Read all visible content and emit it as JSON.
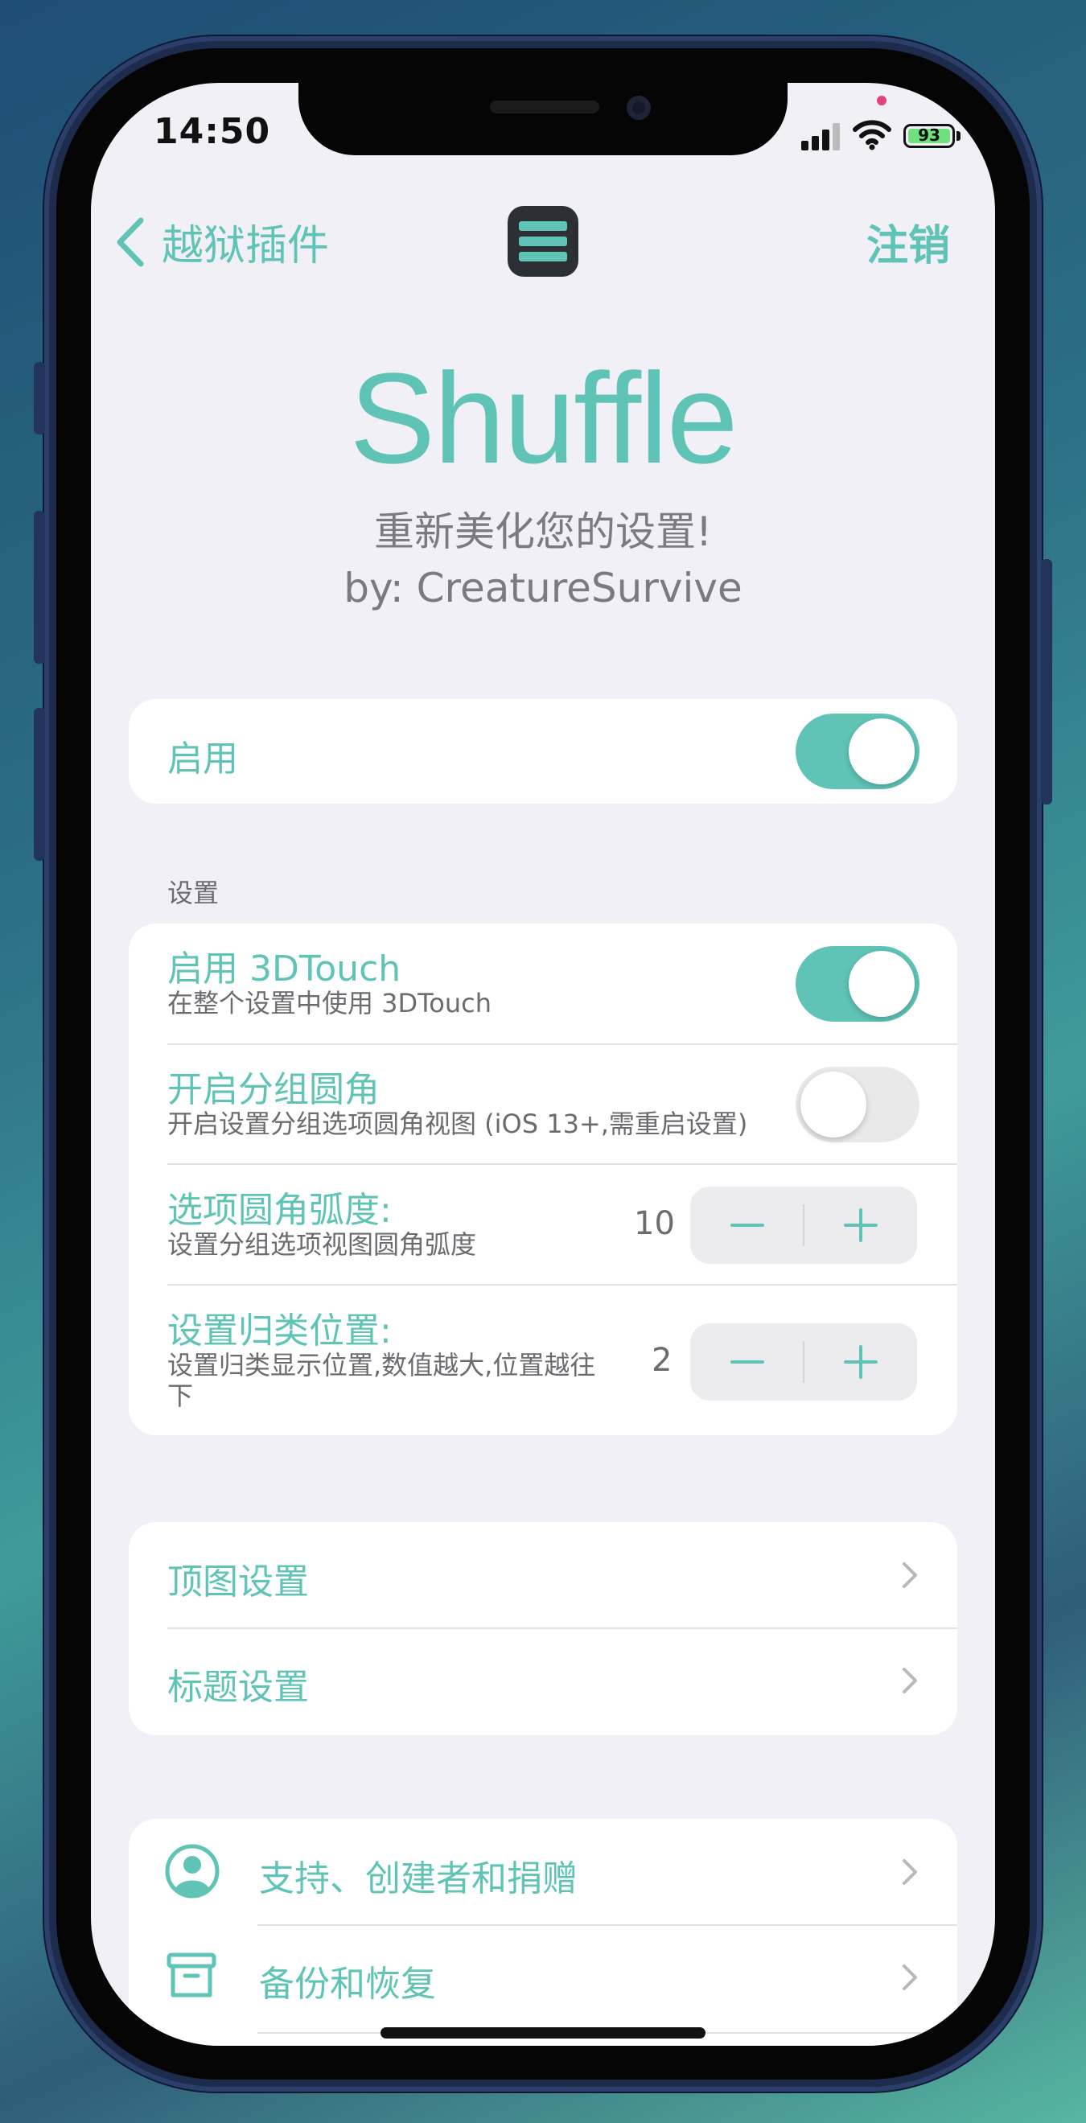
{
  "status_bar": {
    "time": "14:50",
    "battery": "93"
  },
  "nav": {
    "back_label": "越狱插件",
    "right_label": "注销"
  },
  "header": {
    "title": "Shuffle",
    "subtitle": "重新美化您的设置!",
    "author": "by: CreatureSurvive"
  },
  "enable_card": {
    "label": "启用",
    "toggle_on": true
  },
  "settings_section": {
    "header": "设置",
    "rows": [
      {
        "label": "启用 3DTouch",
        "sub": "在整个设置中使用 3DTouch",
        "toggle_on": true
      },
      {
        "label": "开启分组圆角",
        "sub": "开启设置分组选项圆角视图 (iOS 13+,需重启设置)",
        "toggle_on": false
      },
      {
        "label": "选项圆角弧度:",
        "sub": "设置分组选项视图圆角弧度",
        "value": "10"
      },
      {
        "label": "设置归类位置:",
        "sub": "设置归类显示位置,数值越大,位置越往下",
        "value": "2"
      }
    ]
  },
  "nav_card": {
    "items": [
      {
        "label": "顶图设置"
      },
      {
        "label": "标题设置"
      }
    ]
  },
  "more_card": {
    "items": [
      {
        "label": "支持、创建者和捐赠",
        "icon": "person-circle-icon"
      },
      {
        "label": "备份和恢复",
        "icon": "archive-box-icon"
      }
    ]
  },
  "colors": {
    "accent": "#5fc4b5",
    "background": "#f1f0f6"
  }
}
